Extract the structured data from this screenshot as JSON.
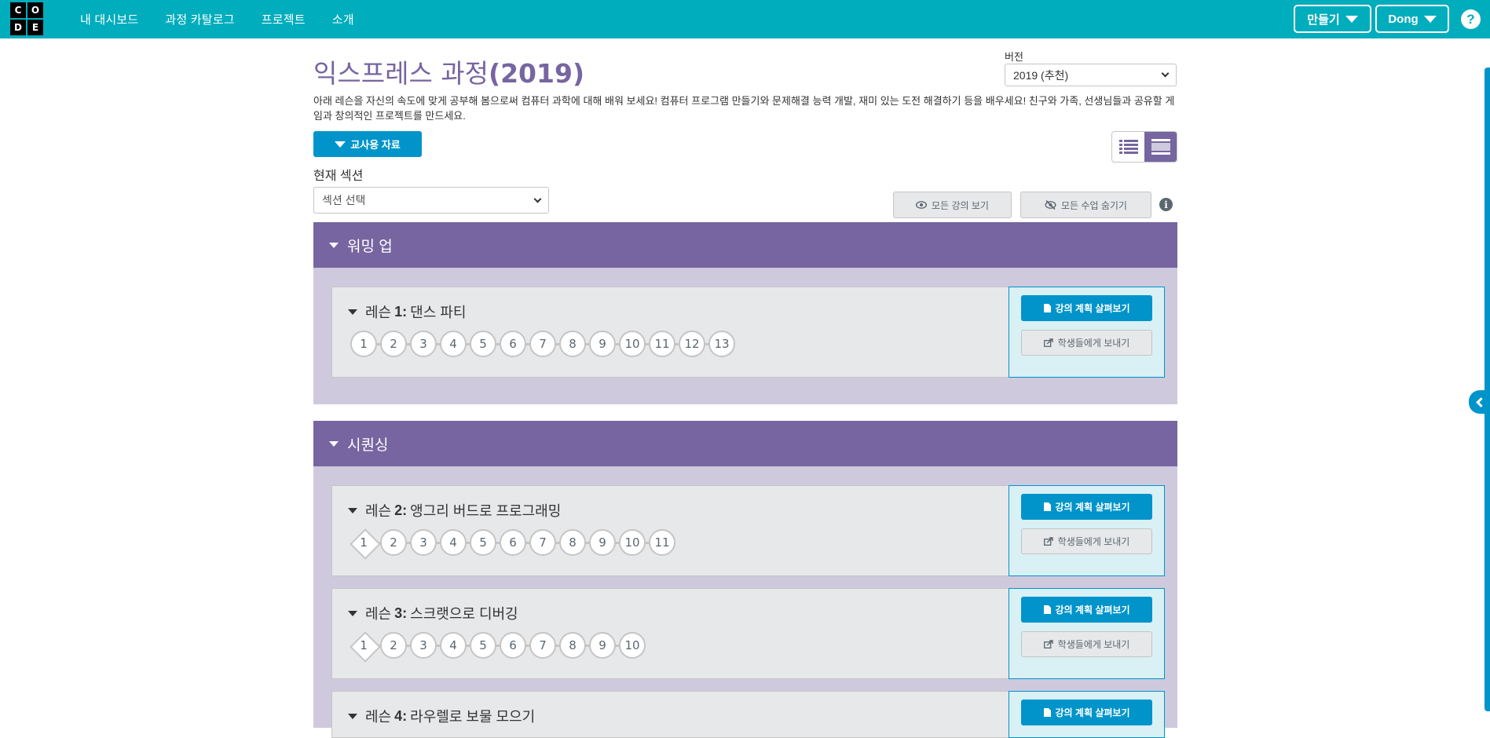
{
  "header": {
    "logo_letters": [
      "C",
      "O",
      "D",
      "E"
    ],
    "nav": [
      "내 대시보드",
      "과정 카탈로그",
      "프로젝트",
      "소개"
    ],
    "create_label": "만들기",
    "user_label": "Dong",
    "help_label": "?",
    "bg_color": "#00adbc"
  },
  "course": {
    "title": "익스프레스 과정",
    "title_year": "(2019)",
    "version_label": "버전",
    "version_value": "2019 (추천)",
    "description": "아래 레슨을 자신의 속도에 맞게 공부해 봄으로써 컴퓨터 과학에 대해 배워 보세요! 컴퓨터 프로그램 만들기와 문제해결 능력 개발, 재미 있는 도전 해결하기 등을 배우세요! 친구와 가족, 선생님들과 공유할 게임과 창의적인 프로젝트를 만드세요.",
    "teacher_resources_label": "교사용 자료",
    "current_section_label": "현재 섹션",
    "section_select_value": "섹션 선택",
    "show_all_label": "모든 강의 보기",
    "hide_all_label": "모든 수업 숨기기",
    "info_icon": "i"
  },
  "colors": {
    "accent": "#7665a0",
    "button_blue": "#0094ca",
    "group_bg": "#cfc9de",
    "lesson_bg": "#e7e8ea"
  },
  "groups": [
    {
      "name": "워밍 업"
    },
    {
      "name": "시퀀싱"
    }
  ],
  "lesson_prefix": "레슨",
  "lessons": [
    {
      "number": "1:",
      "title": "댄스 파티",
      "levels": [
        "1",
        "2",
        "3",
        "4",
        "5",
        "6",
        "7",
        "8",
        "9",
        "10",
        "11",
        "12",
        "13"
      ],
      "first_diamond": false
    },
    {
      "number": "2:",
      "title": "앵그리 버드로 프로그래밍",
      "levels": [
        "1",
        "2",
        "3",
        "4",
        "5",
        "6",
        "7",
        "8",
        "9",
        "10",
        "11"
      ],
      "first_diamond": true
    },
    {
      "number": "3:",
      "title": "스크랫으로 디버깅",
      "levels": [
        "1",
        "2",
        "3",
        "4",
        "5",
        "6",
        "7",
        "8",
        "9",
        "10"
      ],
      "first_diamond": true
    },
    {
      "number": "4:",
      "title": "라우렐로 보물 모으기",
      "levels": [],
      "first_diamond": false
    }
  ],
  "actions": {
    "lesson_plan_label": "강의 계획 살펴보기",
    "send_students_label": "학생들에게 보내기"
  }
}
